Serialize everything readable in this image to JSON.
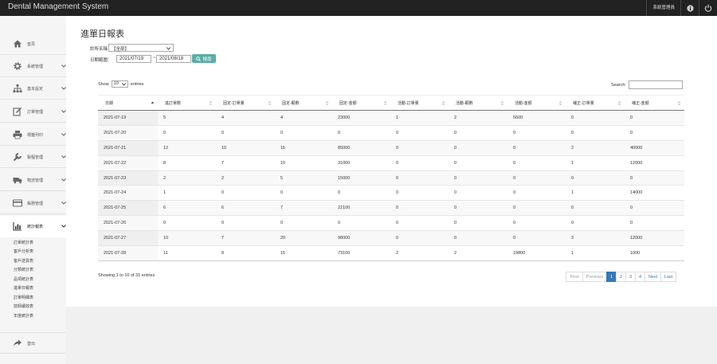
{
  "app": {
    "title": "Dental Management System",
    "user_label": "系統管理員"
  },
  "colors": {
    "topbar": "#222222",
    "primary": "#337ab7",
    "search_button": "#5bada8"
  },
  "sidebar": {
    "items": [
      {
        "label": "首頁",
        "icon": "home-icon"
      },
      {
        "label": "系統管理",
        "icon": "gear-icon"
      },
      {
        "label": "基本設定",
        "icon": "sitemap-icon"
      },
      {
        "label": "訂單管理",
        "icon": "edit-icon"
      },
      {
        "label": "標籤列印",
        "icon": "printer-icon"
      },
      {
        "label": "製程管理",
        "icon": "wrench-icon"
      },
      {
        "label": "物流管理",
        "icon": "truck-icon"
      },
      {
        "label": "帳務管理",
        "icon": "credit-card-icon"
      },
      {
        "label": "統計報表",
        "icon": "bar-chart-icon"
      }
    ],
    "sub_items": [
      "訂單統計表",
      "客戶分析表",
      "客戶送貨表",
      "分類統計表",
      "品項統計表",
      "進單日報表",
      "訂單明細表",
      "技師續效表",
      "年度統計表"
    ],
    "logout": {
      "label": "登出",
      "icon": "share-icon"
    }
  },
  "page": {
    "title": "進單日報表"
  },
  "filters": {
    "clinic_label": "診所名稱：",
    "clinic_value": "【全部】",
    "date_label": "日期範圍：",
    "date_from": "2021/07/19",
    "date_separator": "~",
    "date_to": "2021/08/18",
    "search_button": "搜尋"
  },
  "table_controls": {
    "show_label": "Show",
    "page_size": "10",
    "entries_label": "entries",
    "search_label": "Search:"
  },
  "table": {
    "columns": [
      "日期",
      "進訂單數",
      "固定-訂單量",
      "固定-顆數",
      "固定-金額",
      "活動-訂單量",
      "活動-顆數",
      "活動-金額",
      "補正-訂單量",
      "補正-金額"
    ],
    "rows": [
      [
        "2021-07-19",
        "5",
        "4",
        "4",
        "23000",
        "1",
        "2",
        "5600",
        "0",
        "0"
      ],
      [
        "2021-07-20",
        "0",
        "0",
        "0",
        "0",
        "0",
        "0",
        "0",
        "0",
        "0"
      ],
      [
        "2021-07-21",
        "12",
        "10",
        "15",
        "85000",
        "0",
        "0",
        "0",
        "2",
        "40000"
      ],
      [
        "2021-07-22",
        "8",
        "7",
        "10",
        "31000",
        "0",
        "0",
        "0",
        "1",
        "12000"
      ],
      [
        "2021-07-23",
        "2",
        "2",
        "5",
        "15000",
        "0",
        "0",
        "0",
        "0",
        "0"
      ],
      [
        "2021-07-24",
        "1",
        "0",
        "0",
        "0",
        "0",
        "0",
        "0",
        "1",
        "14000"
      ],
      [
        "2021-07-25",
        "6",
        "6",
        "7",
        "22100",
        "0",
        "0",
        "0",
        "0",
        "0"
      ],
      [
        "2021-07-26",
        "0",
        "0",
        "0",
        "0",
        "0",
        "0",
        "0",
        "0",
        "0"
      ],
      [
        "2021-07-27",
        "10",
        "7",
        "20",
        "98000",
        "0",
        "0",
        "0",
        "3",
        "12000"
      ],
      [
        "2021-07-28",
        "11",
        "8",
        "15",
        "73100",
        "2",
        "2",
        "19800",
        "1",
        "1000"
      ]
    ]
  },
  "info": "Showing 1 to 10 of 31 entries",
  "pagination": {
    "first": "First",
    "previous": "Previous",
    "pages": [
      "1",
      "2",
      "3",
      "4"
    ],
    "current": "1",
    "next": "Next",
    "last": "Last"
  }
}
